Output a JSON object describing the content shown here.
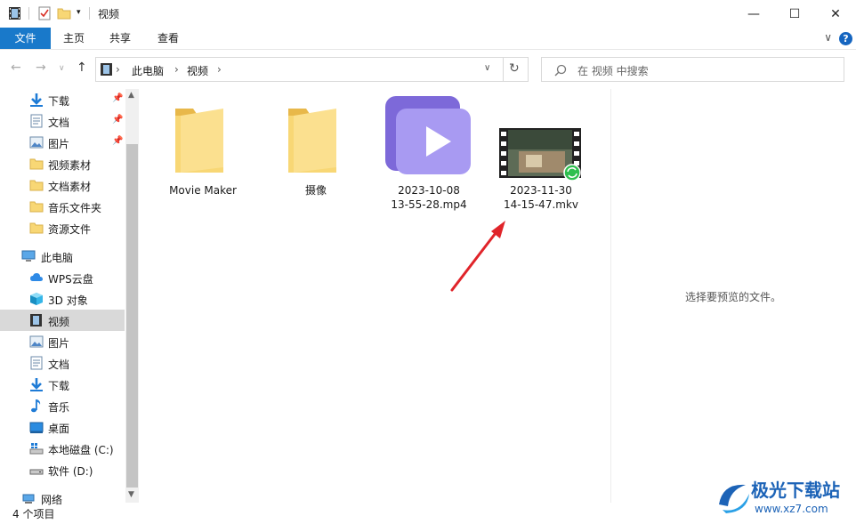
{
  "window": {
    "title": "视频",
    "minimize": "—",
    "maximize": "☐",
    "close": "✕"
  },
  "ribbon": {
    "tabs": [
      "文件",
      "主页",
      "共享",
      "查看"
    ],
    "help": "?"
  },
  "address": {
    "segments": [
      "此电脑",
      "视频"
    ],
    "separator": "›"
  },
  "search": {
    "placeholder": "在 视频 中搜索"
  },
  "sidebar": {
    "quick_access": [
      {
        "label": "下载",
        "icon": "download-icon",
        "pinned": true
      },
      {
        "label": "文档",
        "icon": "document-icon",
        "pinned": true
      },
      {
        "label": "图片",
        "icon": "picture-icon",
        "pinned": true
      },
      {
        "label": "视频素材",
        "icon": "folder-icon",
        "pinned": false
      },
      {
        "label": "文档素材",
        "icon": "folder-icon",
        "pinned": false
      },
      {
        "label": "音乐文件夹",
        "icon": "folder-icon",
        "pinned": false
      },
      {
        "label": "资源文件",
        "icon": "folder-icon",
        "pinned": false
      }
    ],
    "this_pc": {
      "label": "此电脑",
      "icon": "computer-icon"
    },
    "pc_items": [
      {
        "label": "WPS云盘",
        "icon": "cloud-icon"
      },
      {
        "label": "3D 对象",
        "icon": "cube-icon"
      },
      {
        "label": "视频",
        "icon": "video-icon",
        "selected": true
      },
      {
        "label": "图片",
        "icon": "picture-icon"
      },
      {
        "label": "文档",
        "icon": "document-icon"
      },
      {
        "label": "下载",
        "icon": "download-icon"
      },
      {
        "label": "音乐",
        "icon": "music-icon"
      },
      {
        "label": "桌面",
        "icon": "desktop-icon"
      },
      {
        "label": "本地磁盘 (C:)",
        "icon": "drive-icon"
      },
      {
        "label": "软件 (D:)",
        "icon": "drive-icon"
      }
    ],
    "network": {
      "label": "网络",
      "icon": "network-icon"
    }
  },
  "files": [
    {
      "line1": "Movie Maker",
      "line2": "",
      "type": "folder"
    },
    {
      "line1": "摄像",
      "line2": "",
      "type": "folder"
    },
    {
      "line1": "2023-10-08",
      "line2": "13-55-28.mp4",
      "type": "mp4"
    },
    {
      "line1": "2023-11-30",
      "line2": "14-15-47.mkv",
      "type": "mkv"
    }
  ],
  "preview": {
    "message": "选择要预览的文件。"
  },
  "status": {
    "count": "4 个项目"
  },
  "watermark": {
    "title": "极光下载站",
    "url": "www.xz7.com"
  },
  "colors": {
    "accent": "#1979ca",
    "folder": "#f8d775",
    "arrow": "#e0242a",
    "selection": "#d9d9d9"
  }
}
